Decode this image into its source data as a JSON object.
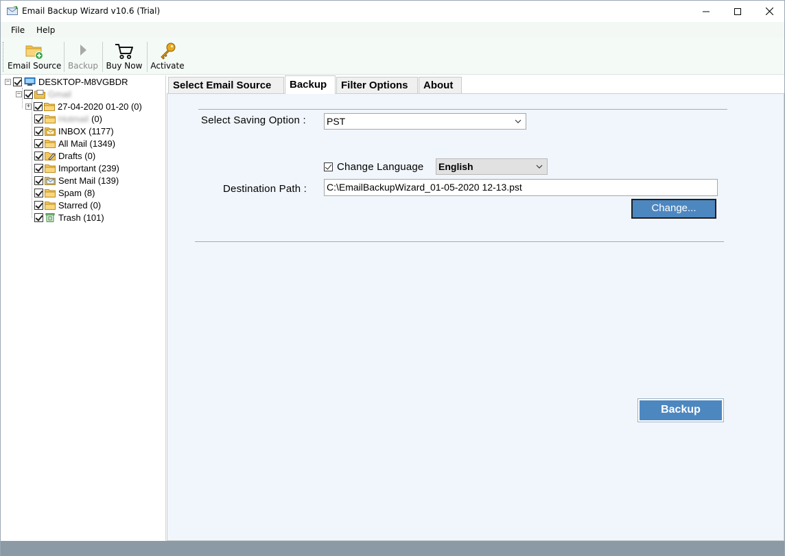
{
  "window": {
    "title": "Email Backup Wizard v10.6 (Trial)"
  },
  "menu": {
    "items": [
      {
        "label": "File"
      },
      {
        "label": "Help"
      }
    ]
  },
  "toolbar": {
    "email_source": "Email Source",
    "backup": "Backup",
    "buy_now": "Buy Now",
    "activate": "Activate"
  },
  "tree": {
    "root": "DESKTOP-M8VGBDR",
    "account": "Gmail",
    "items": [
      {
        "label": "27-04-2020 01-20 (0)",
        "icon": "folder-icon"
      },
      {
        "label": "Hotmail",
        "count": "(0)",
        "icon": "folder-icon"
      },
      {
        "label": "INBOX (1177)",
        "icon": "inbox-icon"
      },
      {
        "label": "All Mail (1349)",
        "icon": "folder-icon"
      },
      {
        "label": "Drafts (0)",
        "icon": "drafts-icon"
      },
      {
        "label": "Important (239)",
        "icon": "folder-icon"
      },
      {
        "label": "Sent Mail (139)",
        "icon": "sent-icon"
      },
      {
        "label": "Spam (8)",
        "icon": "folder-icon"
      },
      {
        "label": "Starred (0)",
        "icon": "folder-icon"
      },
      {
        "label": "Trash (101)",
        "icon": "trash-icon"
      }
    ]
  },
  "tabs": [
    {
      "label": "Select Email Source",
      "active": false
    },
    {
      "label": "Backup",
      "active": true
    },
    {
      "label": "Filter Options",
      "active": false
    },
    {
      "label": "About",
      "active": false
    }
  ],
  "backup_panel": {
    "saving_option_label": "Select Saving Option :",
    "saving_option_value": "PST",
    "change_language_label": "Change Language",
    "change_language_checked": true,
    "language_value": "English",
    "destination_label": "Destination Path :",
    "destination_value": "C:\\EmailBackupWizard_01-05-2020 12-13.pst",
    "change_button": "Change...",
    "backup_button": "Backup"
  },
  "colors": {
    "button_blue": "#4d87c0",
    "panel_bg": "#f0f6fb",
    "status_bar": "#8b9aa5"
  }
}
